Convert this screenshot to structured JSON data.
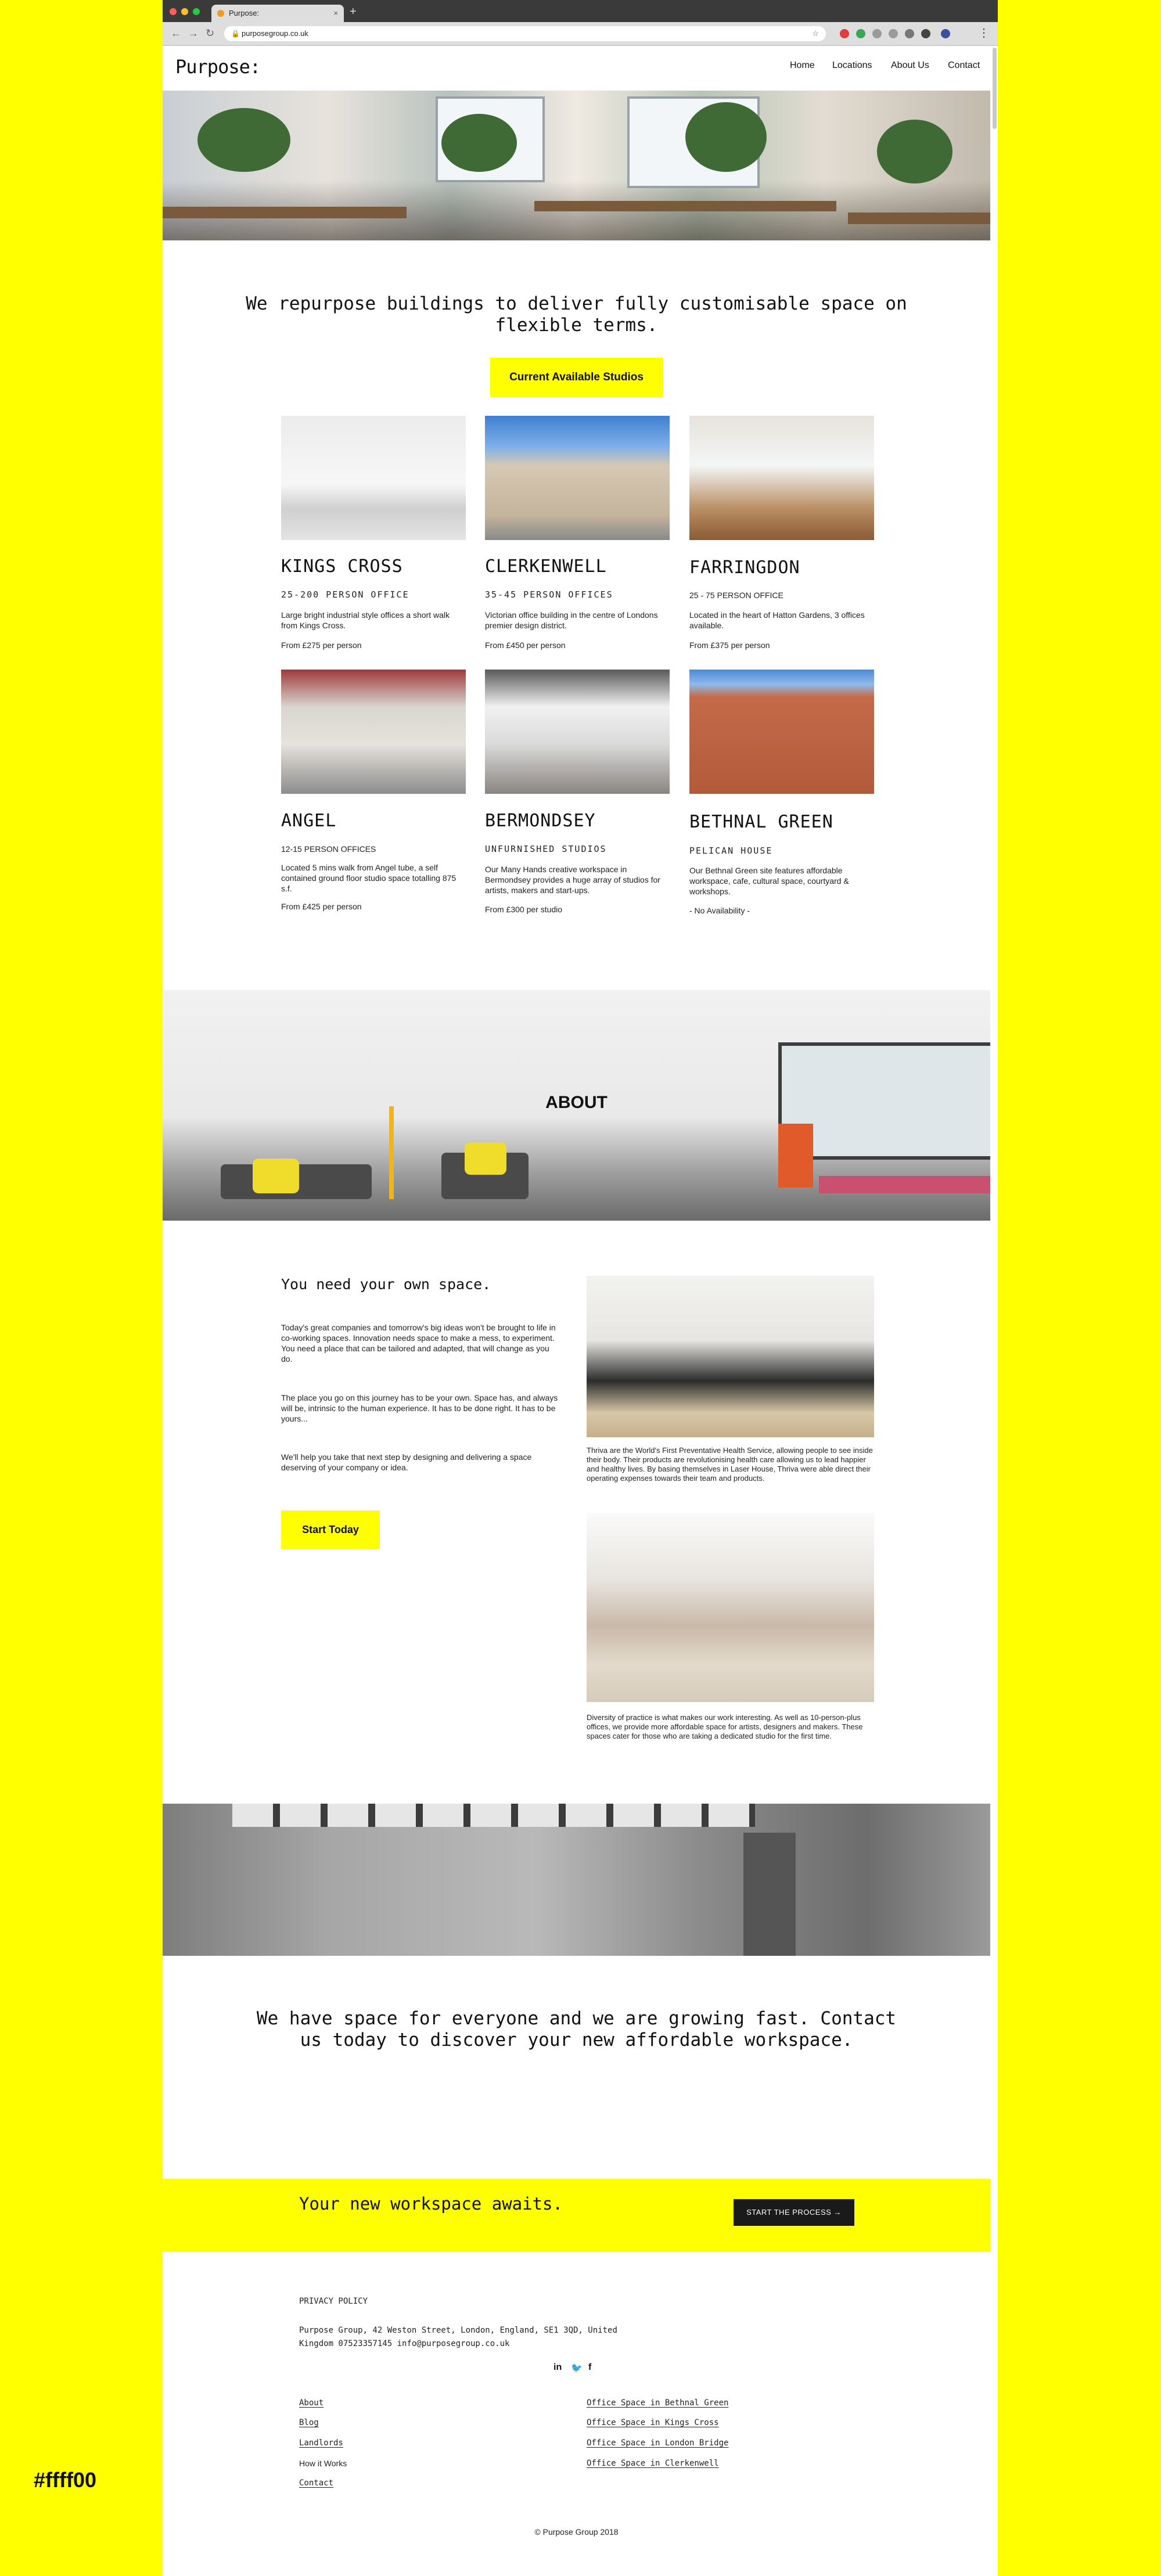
{
  "swatch_label": "#ffff00",
  "browser": {
    "tab_title": "Purpose:",
    "tab_close": "×",
    "new_tab": "+",
    "back": "←",
    "forward": "→",
    "reload": "↻",
    "lock": "🔒",
    "url": "purposegroup.co.uk",
    "star": "☆",
    "menu": "⋮"
  },
  "header": {
    "logo": "Purpose:",
    "nav": [
      "Home",
      "Locations",
      "About Us",
      "Contact"
    ]
  },
  "intro": {
    "headline": "We repurpose buildings to deliver fully customisable space on flexible terms.",
    "button": "Current Available Studios"
  },
  "locations": [
    {
      "name": "KINGS CROSS",
      "sub": "25-200 PERSON OFFICE",
      "desc": "Large bright industrial style offices a short walk from Kings Cross.",
      "price": "From £275 per person"
    },
    {
      "name": "CLERKENWELL",
      "sub": "35-45 PERSON OFFICES",
      "desc": "Victorian office building in the centre of Londons premier design district.",
      "price": "From £450 per person"
    },
    {
      "name": "FARRINGDON",
      "sub": "25 - 75 PERSON OFFICE",
      "desc": "Located in the heart of Hatton Gardens, 3 offices available.",
      "price": "From £375 per person"
    },
    {
      "name": "ANGEL",
      "sub": "12-15 PERSON OFFICES",
      "desc": "Located 5 mins walk from Angel tube, a self contained ground floor studio space totalling 875 s.f.",
      "price": "From £425 per person"
    },
    {
      "name": "BERMONDSEY",
      "sub": "UNFURNISHED STUDIOS",
      "desc": "Our Many Hands creative workspace in Bermondsey provides a huge array of studios for artists, makers and start-ups.",
      "price": "From £300 per studio"
    },
    {
      "name": "BETHNAL GREEN",
      "sub": "PELICAN HOUSE",
      "desc": "Our Bethnal Green site features affordable workspace, cafe, cultural space, courtyard & workshops.",
      "price": "- No Availability -"
    }
  ],
  "about": {
    "title": "ABOUT",
    "heading": "You need your own space.",
    "paragraphs": [
      "Today's great companies and tomorrow's big ideas won't be brought to life in co-working spaces. Innovation needs space to make a mess, to experiment. You need a place that can be tailored and adapted, that will change as you do.",
      "The place you go on this journey has to be your own. Space has, and always will be, intrinsic to the human experience. It has to be done right. It has to be yours...",
      "We'll help you take that next step by designing and delivering a space deserving of your company or idea."
    ],
    "button": "Start Today",
    "captions": [
      "Thriva are the World's First Preventative Health Service, allowing people to see inside their body. Their products are revolutionising health care allowing us to lead happier and healthy lives. By basing themselves in Laser House, Thriva were able direct their operating expenses towards their team and products.",
      "Diversity of practice is what makes our work interesting. As well as 10-person-plus offices, we provide more affordable space for artists, designers and makers. These spaces cater for those who are taking a dedicated studio for the first time."
    ]
  },
  "closing": {
    "text": "We have space for everyone and we are growing fast. Contact us today to discover your new affordable workspace."
  },
  "cta": {
    "text": "Your new workspace awaits.",
    "button": "START THE PROCESS →"
  },
  "footer": {
    "privacy": "PRIVACY POLICY",
    "address_line1": "Purpose Group, 42 Weston Street, London, England, SE1 3QD, United",
    "address_line2": "Kingdom  07523357145  info@purposegroup.co.uk",
    "social": [
      "in",
      "🐦",
      "f"
    ],
    "links_left": [
      "About",
      "Blog",
      "Landlords",
      "How it Works",
      "Contact"
    ],
    "links_right": [
      "Office Space in Bethnal Green",
      "Office Space in Kings Cross",
      "Office Space in London Bridge",
      "Office Space in Clerkenwell"
    ],
    "copyright": "© Purpose Group 2018"
  }
}
